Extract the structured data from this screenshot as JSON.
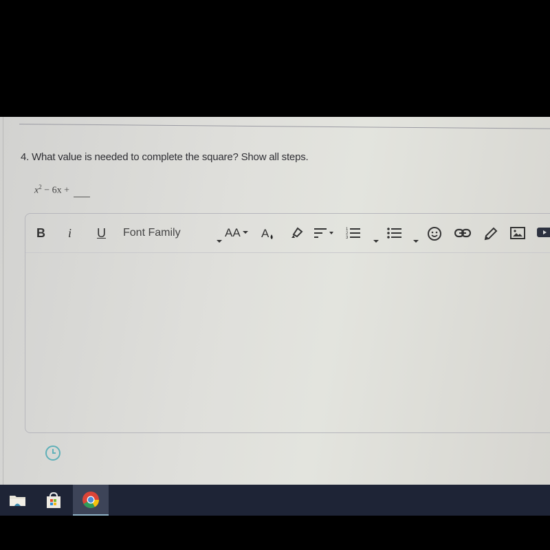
{
  "question": {
    "number_text": "4. What value is needed to complete the square? Show all steps.",
    "expression": {
      "base": "x",
      "exponent": "2",
      "rest": " − 6x + "
    }
  },
  "editor": {
    "toolbar": {
      "bold_label": "B",
      "italic_label": "i",
      "underline_label": "U",
      "font_family_label": "Font Family",
      "font_size_label": "AA",
      "icons": [
        "font-color-icon",
        "highlight-icon",
        "align-icon",
        "numbered-list-icon",
        "bullet-list-icon",
        "emoji-icon",
        "link-icon",
        "draw-icon",
        "image-icon",
        "video-icon"
      ]
    },
    "content": ""
  },
  "footer": {
    "icon": "clock-icon"
  },
  "taskbar": {
    "apps": [
      {
        "name": "File Explorer",
        "icon": "folder-icon",
        "active": false
      },
      {
        "name": "Microsoft Store",
        "icon": "store-icon",
        "active": false
      },
      {
        "name": "Google Chrome",
        "icon": "chrome-icon",
        "active": true
      }
    ]
  }
}
